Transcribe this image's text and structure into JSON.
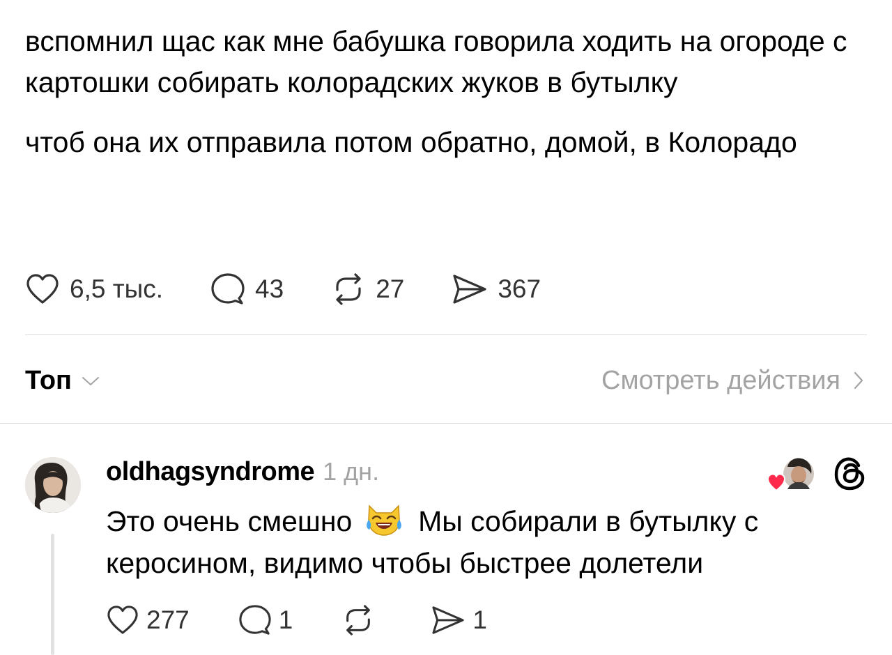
{
  "post": {
    "paragraphs": [
      "вспомнил щас как мне бабушка говорила ходить на огороде с картошки собирать колорадских жуков в бутылку",
      "чтоб она их отправила потом обратно, домой, в Колорадо"
    ],
    "actions": {
      "likes": {
        "icon": "heart-icon",
        "count": "6,5 тыс."
      },
      "replies": {
        "icon": "comment-bubble-icon",
        "count": "43"
      },
      "reposts": {
        "icon": "repost-icon",
        "count": "27"
      },
      "shares": {
        "icon": "send-icon",
        "count": "367"
      }
    }
  },
  "sort": {
    "label": "Топ",
    "icon": "chevron-down-icon"
  },
  "view_activity": {
    "label": "Смотреть действия",
    "icon": "chevron-right-icon"
  },
  "reply": {
    "username": "oldhagsyndrome",
    "timestamp": "1 дн.",
    "text_before_emoji": "Это очень смешно",
    "emoji": "cat-tears-of-joy-emoji",
    "text_after_emoji": "Мы собирали в бутылку с керосином, видимо чтобы быстрее долетели",
    "liked_by_author_icon": "liked-by-author-icon",
    "app_icon": "threads-logo-icon",
    "actions": {
      "likes": {
        "icon": "heart-icon",
        "count": "277"
      },
      "replies": {
        "icon": "comment-bubble-icon",
        "count": "1"
      },
      "reposts": {
        "icon": "repost-icon",
        "count": ""
      },
      "shares": {
        "icon": "send-icon",
        "count": "1"
      }
    }
  },
  "colors": {
    "text": "#000000",
    "secondary_text": "#a3a3a3",
    "icon": "#333333",
    "divider": "#dcdcdc",
    "like_heart": "#ff2a4b"
  }
}
